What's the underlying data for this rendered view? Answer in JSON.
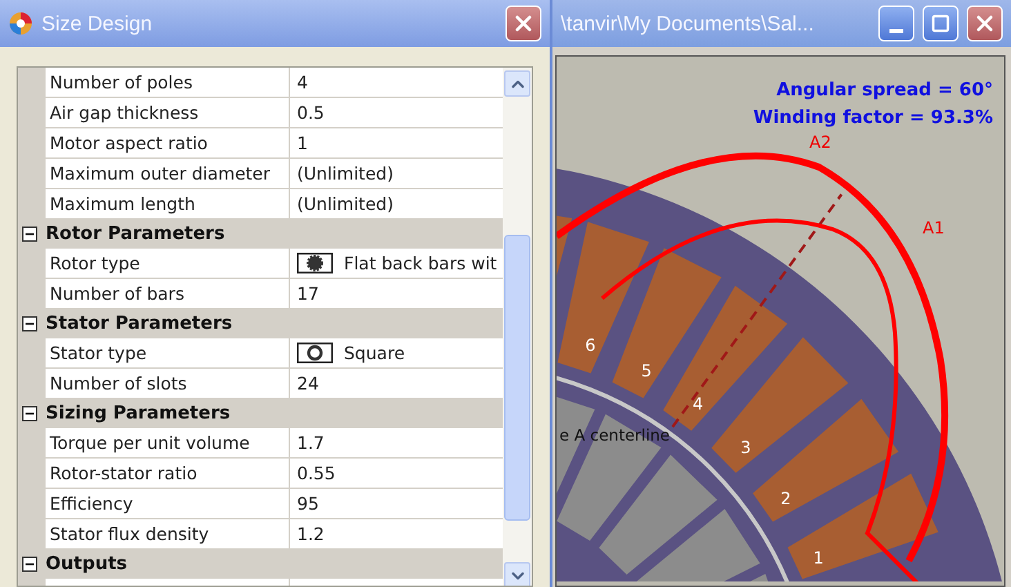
{
  "dialog": {
    "title": "Size Design",
    "top_rows": [
      {
        "name": "Number of poles",
        "value": "4"
      },
      {
        "name": "Air gap thickness",
        "value": "0.5"
      },
      {
        "name": "Motor aspect ratio",
        "value": "1"
      },
      {
        "name": "Maximum outer diameter",
        "value": "(Unlimited)"
      },
      {
        "name": "Maximum length",
        "value": "(Unlimited)"
      }
    ],
    "groups": [
      {
        "title": "Rotor Parameters",
        "expanded": true,
        "rows": [
          {
            "name": "Rotor type",
            "value": "Flat back bars wit",
            "kind": "rotor"
          },
          {
            "name": "Number of bars",
            "value": "17",
            "kind": "text"
          }
        ]
      },
      {
        "title": "Stator Parameters",
        "expanded": true,
        "rows": [
          {
            "name": "Stator type",
            "value": "Square",
            "kind": "stator"
          },
          {
            "name": "Number of slots",
            "value": "24",
            "kind": "text"
          }
        ]
      },
      {
        "title": "Sizing Parameters",
        "expanded": true,
        "rows": [
          {
            "name": "Torque per unit volume",
            "value": "1.7",
            "kind": "text"
          },
          {
            "name": "Rotor-stator ratio",
            "value": "0.55",
            "kind": "text"
          },
          {
            "name": "Efficiency",
            "value": "95",
            "kind": "text"
          },
          {
            "name": "Stator flux density",
            "value": "1.2",
            "kind": "text"
          }
        ]
      },
      {
        "title": "Outputs",
        "expanded": true
      }
    ]
  },
  "main_window": {
    "title": "\\tanvir\\My Documents\\Sal...",
    "canvas": {
      "annotations": [
        "Angular spread = 60°",
        "Winding factor = 93.3%"
      ],
      "arc_labels": [
        "A2",
        "A1"
      ],
      "slot_numbers": [
        "1",
        "2",
        "3",
        "4",
        "5",
        "6"
      ],
      "centerline_label": "e A centerline"
    }
  }
}
